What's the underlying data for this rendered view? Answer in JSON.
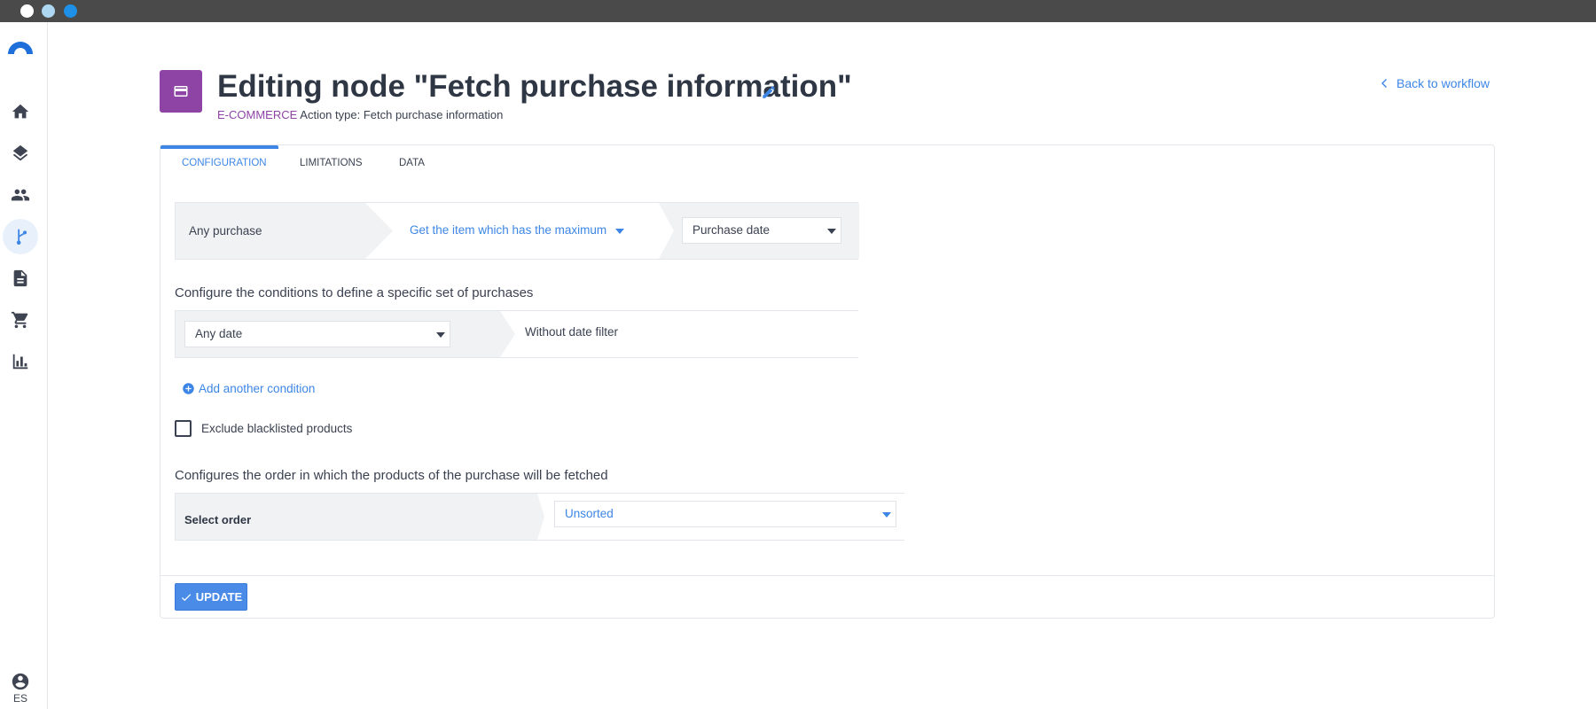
{
  "window": {
    "controls": [
      "close",
      "minimize",
      "maximize"
    ]
  },
  "sidebar": {
    "items": [
      {
        "icon": "home-icon"
      },
      {
        "icon": "layers-icon"
      },
      {
        "icon": "people-icon"
      },
      {
        "icon": "workflow-icon",
        "active": true
      },
      {
        "icon": "document-icon"
      },
      {
        "icon": "cart-icon"
      },
      {
        "icon": "bar-chart-icon"
      }
    ],
    "language": "ES"
  },
  "header": {
    "title": "Editing node \"Fetch purchase information\"",
    "category": "E-COMMERCE",
    "action_type": "Action type: Fetch purchase information",
    "back_label": "Back to workflow",
    "icon_color": "#8e44a5"
  },
  "tabs": [
    {
      "label": "CONFIGURATION",
      "active": true
    },
    {
      "label": "LIMITATIONS",
      "active": false
    },
    {
      "label": "DATA",
      "active": false
    }
  ],
  "config": {
    "purchase_scope": "Any purchase",
    "aggregation": "Get the item which has the maximum",
    "field": "Purchase date",
    "conditions_label": "Configure the conditions to define a specific set of purchases",
    "date_select": "Any date",
    "date_filter_text": "Without date filter",
    "add_condition": "Add another condition",
    "exclude_blacklisted": "Exclude blacklisted products",
    "exclude_checked": false,
    "order_label": "Configures the order in which the products of the purchase will be fetched",
    "order_title": "Select order",
    "order_select": "Unsorted"
  },
  "actions": {
    "update": "UPDATE"
  },
  "colors": {
    "accent": "#3d86e6",
    "brand": "#8e44a5",
    "button": "#4a8be8"
  }
}
